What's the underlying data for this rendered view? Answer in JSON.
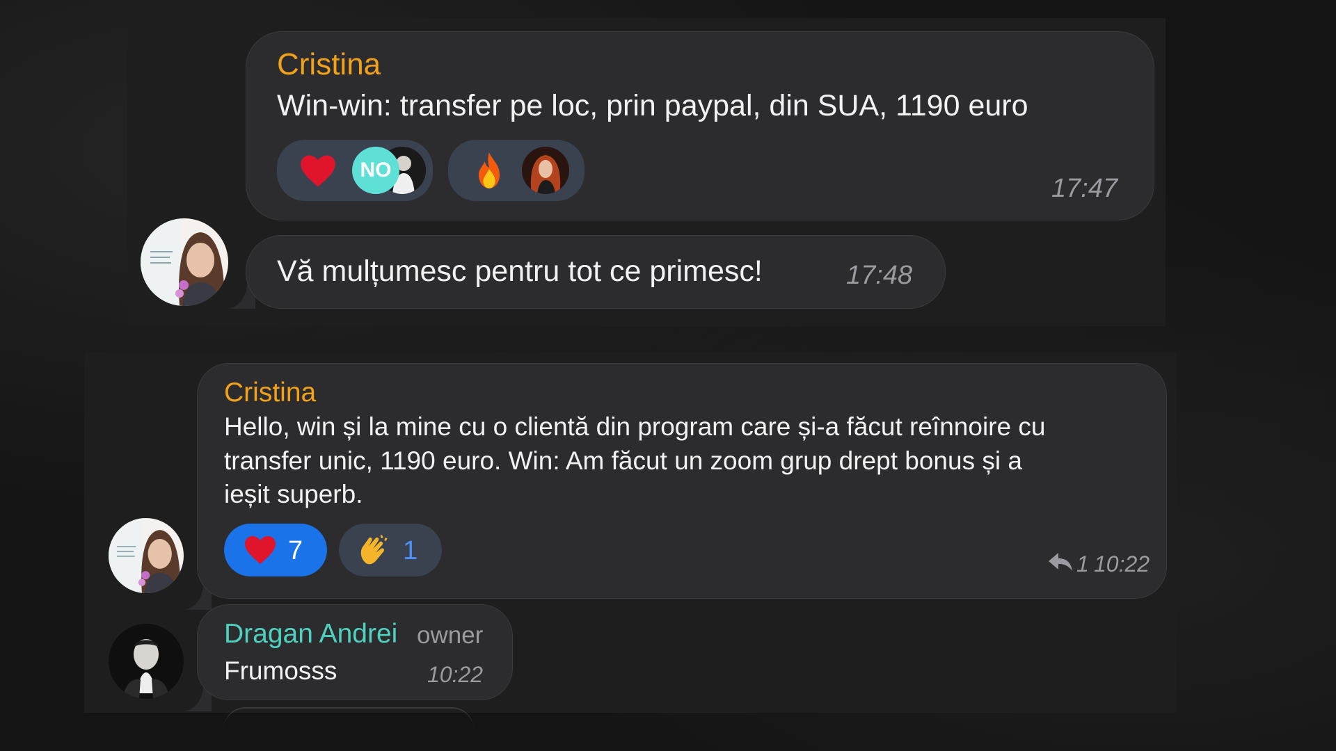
{
  "screenshot_1": {
    "message_1": {
      "sender": "Cristina",
      "text": "Win-win: transfer pe loc, prin paypal, din SUA, 1190 euro",
      "time": "17:47",
      "reactions": [
        {
          "emoji": "heart-icon",
          "avatars": [
            "NO",
            "avatar-man-photo"
          ]
        },
        {
          "emoji": "fire-icon",
          "avatars": [
            "avatar-woman-red-hair"
          ]
        }
      ]
    },
    "message_2": {
      "text": "Vă mulțumesc pentru tot ce primesc!",
      "time": "17:48"
    }
  },
  "screenshot_2": {
    "message_1": {
      "sender": "Cristina",
      "text_lines": [
        "Hello, win și la mine cu o clientă din program care și-a făcut reînnoire cu",
        "transfer unic, 1190 euro. Win: Am făcut un zoom grup drept bonus și a",
        "ieșit superb."
      ],
      "reactions": [
        {
          "emoji": "heart-icon",
          "count": "7",
          "active": true
        },
        {
          "emoji": "clap-icon",
          "count": "1",
          "active": false
        }
      ],
      "replies": "1",
      "time": "10:22"
    },
    "message_2": {
      "sender": "Dragan Andrei",
      "role": "owner",
      "text": "Frumosss",
      "time": "10:22"
    }
  },
  "colors": {
    "sender_name": "#f2a11a",
    "owner_name": "#4fd1bf",
    "bubble": "#2c2c2e",
    "active_reaction": "#1a73e8",
    "reaction_pill": "#3a4250"
  }
}
